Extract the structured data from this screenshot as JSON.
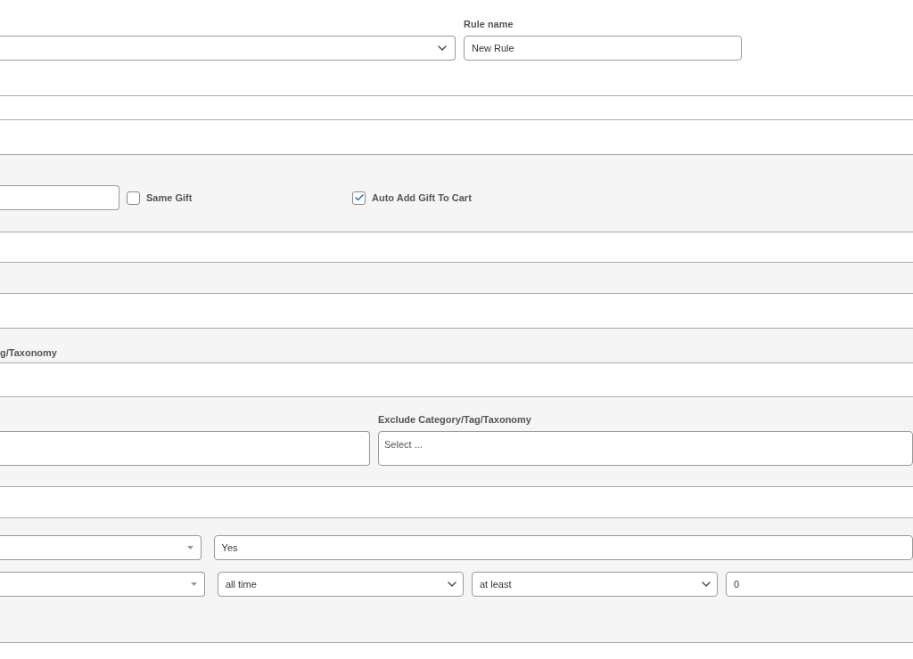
{
  "rule_name": {
    "label": "Rule name",
    "value": "New Rule"
  },
  "gift_options": [
    {
      "label": "Same Gift",
      "checked": false
    },
    {
      "label": "Auto Add Gift To Cart",
      "checked": true
    }
  ],
  "category_label": "g/Taxonomy",
  "exclude_category": {
    "label": "Exclude Category/Tag/Taxonomy",
    "placeholder": "Select ..."
  },
  "condition_value": "Yes",
  "history": {
    "period": "all time",
    "comparison": "at least",
    "amount": "0"
  }
}
